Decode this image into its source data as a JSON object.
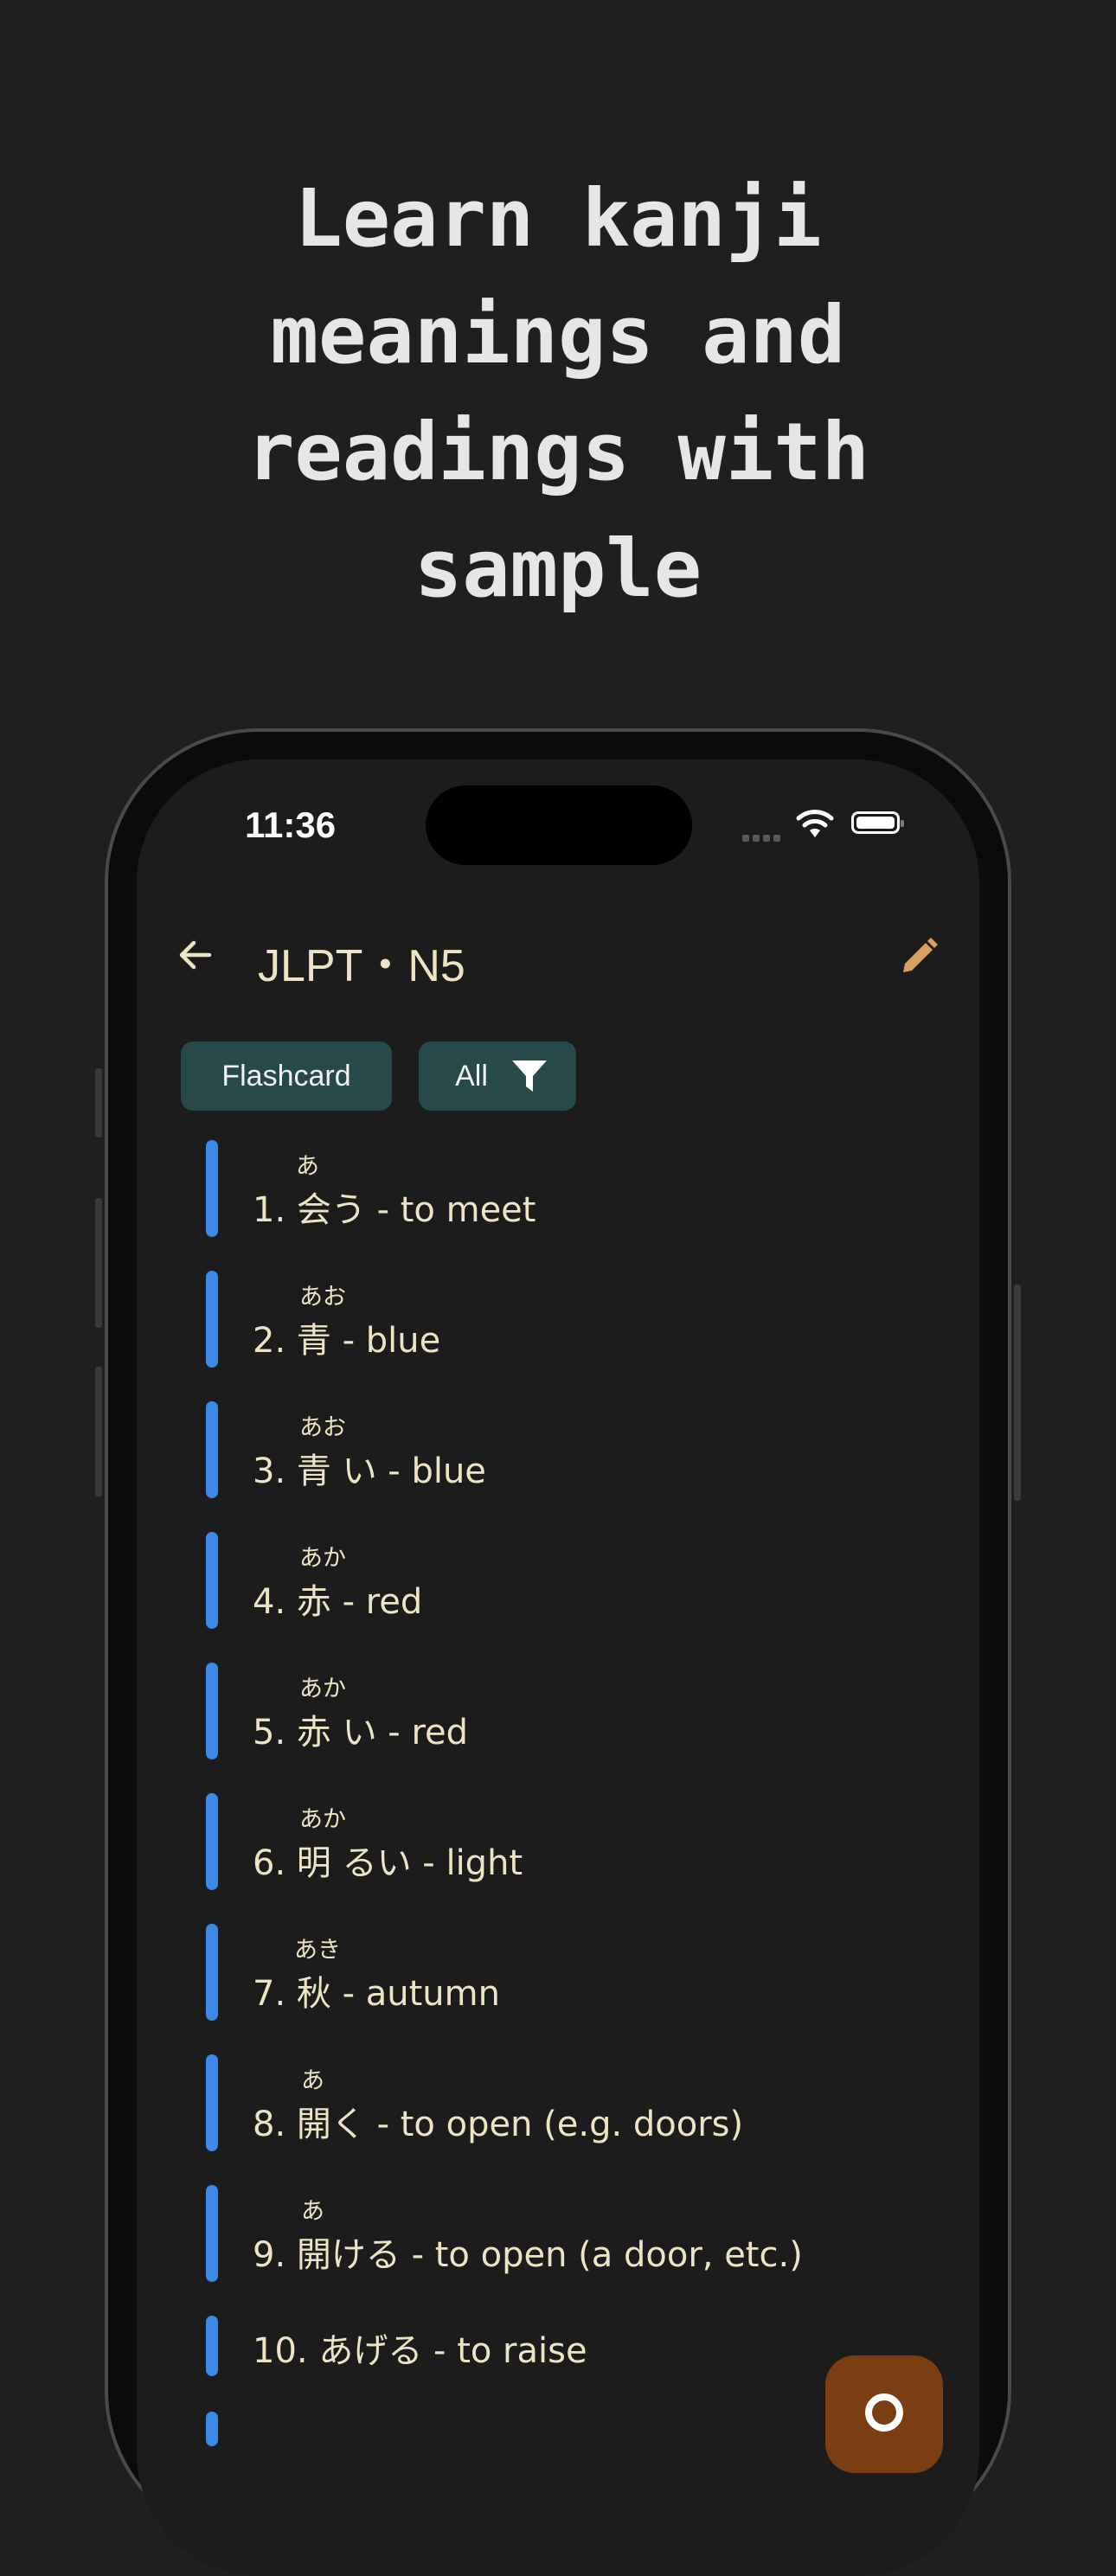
{
  "headline": "Learn kanji\nmeanings and\nreadings with\nsample",
  "status_bar": {
    "time": "11:36"
  },
  "nav": {
    "title": "JLPT・N5",
    "back_icon": "arrow-left-icon",
    "edit_icon": "pencil-icon"
  },
  "chips": {
    "flashcard": "Flashcard",
    "all": "All",
    "filter_icon": "filter-icon"
  },
  "colors": {
    "accent_bar": "#3a8ae6",
    "chip_bg": "#27494a",
    "text": "#ece4c4",
    "fab": "#7a3e12",
    "edit_icon": "#d9a060"
  },
  "list": [
    {
      "reading": "あ",
      "text": "1. 会う - to meet"
    },
    {
      "reading": "あお",
      "text": "2. 青  - blue"
    },
    {
      "reading": "あお",
      "text": "3. 青 い - blue"
    },
    {
      "reading": "あか",
      "text": "4. 赤  - red"
    },
    {
      "reading": "あか",
      "text": "5. 赤 い - red"
    },
    {
      "reading": "あか",
      "text": "6. 明 るい - light"
    },
    {
      "reading": "あき",
      "text": "7. 秋  - autumn"
    },
    {
      "reading": "あ",
      "text": "8. 開く - to open (e.g. doors)"
    },
    {
      "reading": "あ",
      "text": "9. 開ける - to open (a door, etc.)"
    },
    {
      "reading": "",
      "text": "10. あげる - to raise"
    }
  ]
}
